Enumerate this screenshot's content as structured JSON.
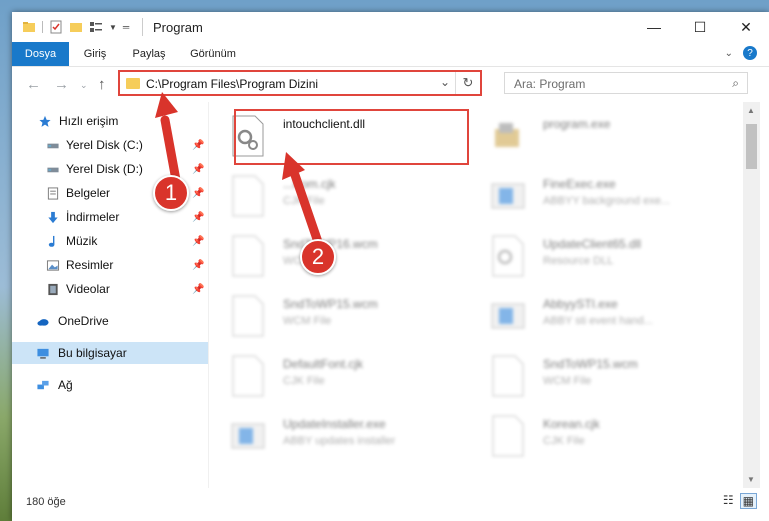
{
  "window": {
    "title": "Program",
    "controls": [
      "minimize",
      "maximize",
      "close"
    ]
  },
  "ribbon": {
    "tabs": [
      {
        "label": "Dosya",
        "active": true
      },
      {
        "label": "Giriş",
        "active": false
      },
      {
        "label": "Paylaş",
        "active": false
      },
      {
        "label": "Görünüm",
        "active": false
      }
    ]
  },
  "navbar": {
    "address_path": "C:\\Program Files\\Program Dizini",
    "search_placeholder": "Ara: Program"
  },
  "sidebar": {
    "items": [
      {
        "label": "Hızlı erişim",
        "icon": "star-icon",
        "pinned": false
      },
      {
        "label": "Yerel Disk (C:)",
        "icon": "drive-icon",
        "pinned": true
      },
      {
        "label": "Yerel Disk (D:)",
        "icon": "drive-icon",
        "pinned": true
      },
      {
        "label": "Belgeler",
        "icon": "documents-icon",
        "pinned": true
      },
      {
        "label": "İndirmeler",
        "icon": "download-icon",
        "pinned": true
      },
      {
        "label": "Müzik",
        "icon": "music-icon",
        "pinned": true
      },
      {
        "label": "Resimler",
        "icon": "pictures-icon",
        "pinned": true
      },
      {
        "label": "Videolar",
        "icon": "video-icon",
        "pinned": true
      },
      {
        "label": "OneDrive",
        "icon": "cloud-icon",
        "pinned": false
      },
      {
        "label": "Bu bilgisayar",
        "icon": "computer-icon",
        "pinned": false,
        "selected": true
      },
      {
        "label": "Ağ",
        "icon": "network-icon",
        "pinned": false
      }
    ]
  },
  "files": [
    {
      "name": "intouchclient.dll",
      "type": "",
      "icon": "dll-gear-icon",
      "highlighted": true
    },
    {
      "name": "program.exe",
      "type": "",
      "icon": "exe-icon",
      "faded": true
    },
    {
      "name": "...Kom.cjk",
      "type": "CJK File",
      "icon": "blank-file-icon",
      "faded": true
    },
    {
      "name": "FineExec.exe",
      "type": "ABBYY background exe...",
      "icon": "app-window-icon",
      "faded": true
    },
    {
      "name": "SndToWP16.wcm",
      "type": "WCM File",
      "icon": "blank-file-icon",
      "faded": true
    },
    {
      "name": "UpdateClient65.dll",
      "type": "Resource DLL",
      "icon": "dll-gear-icon",
      "faded": true
    },
    {
      "name": "SndToWP15.wcm",
      "type": "WCM File",
      "icon": "blank-file-icon",
      "faded": true
    },
    {
      "name": "AbbyySTI.exe",
      "type": "ABBY sti event hand...",
      "icon": "app-window-icon",
      "faded": true
    },
    {
      "name": "DefaultFont.cjk",
      "type": "CJK File",
      "icon": "blank-file-icon",
      "faded": true
    },
    {
      "name": "SndToWP15.wcm",
      "type": "WCM File",
      "icon": "blank-file-icon",
      "faded": true
    },
    {
      "name": "UpdateInstaller.exe",
      "type": "ABBY updates installer",
      "icon": "app-window-icon",
      "faded": true
    },
    {
      "name": "Korean.cjk",
      "type": "CJK File",
      "icon": "blank-file-icon",
      "faded": true
    }
  ],
  "status": {
    "item_count": "180 öğe"
  },
  "callouts": [
    "1",
    "2"
  ],
  "colors": {
    "accent": "#1979ca",
    "highlight_red": "#e0453c",
    "selection": "#cce4f7"
  }
}
